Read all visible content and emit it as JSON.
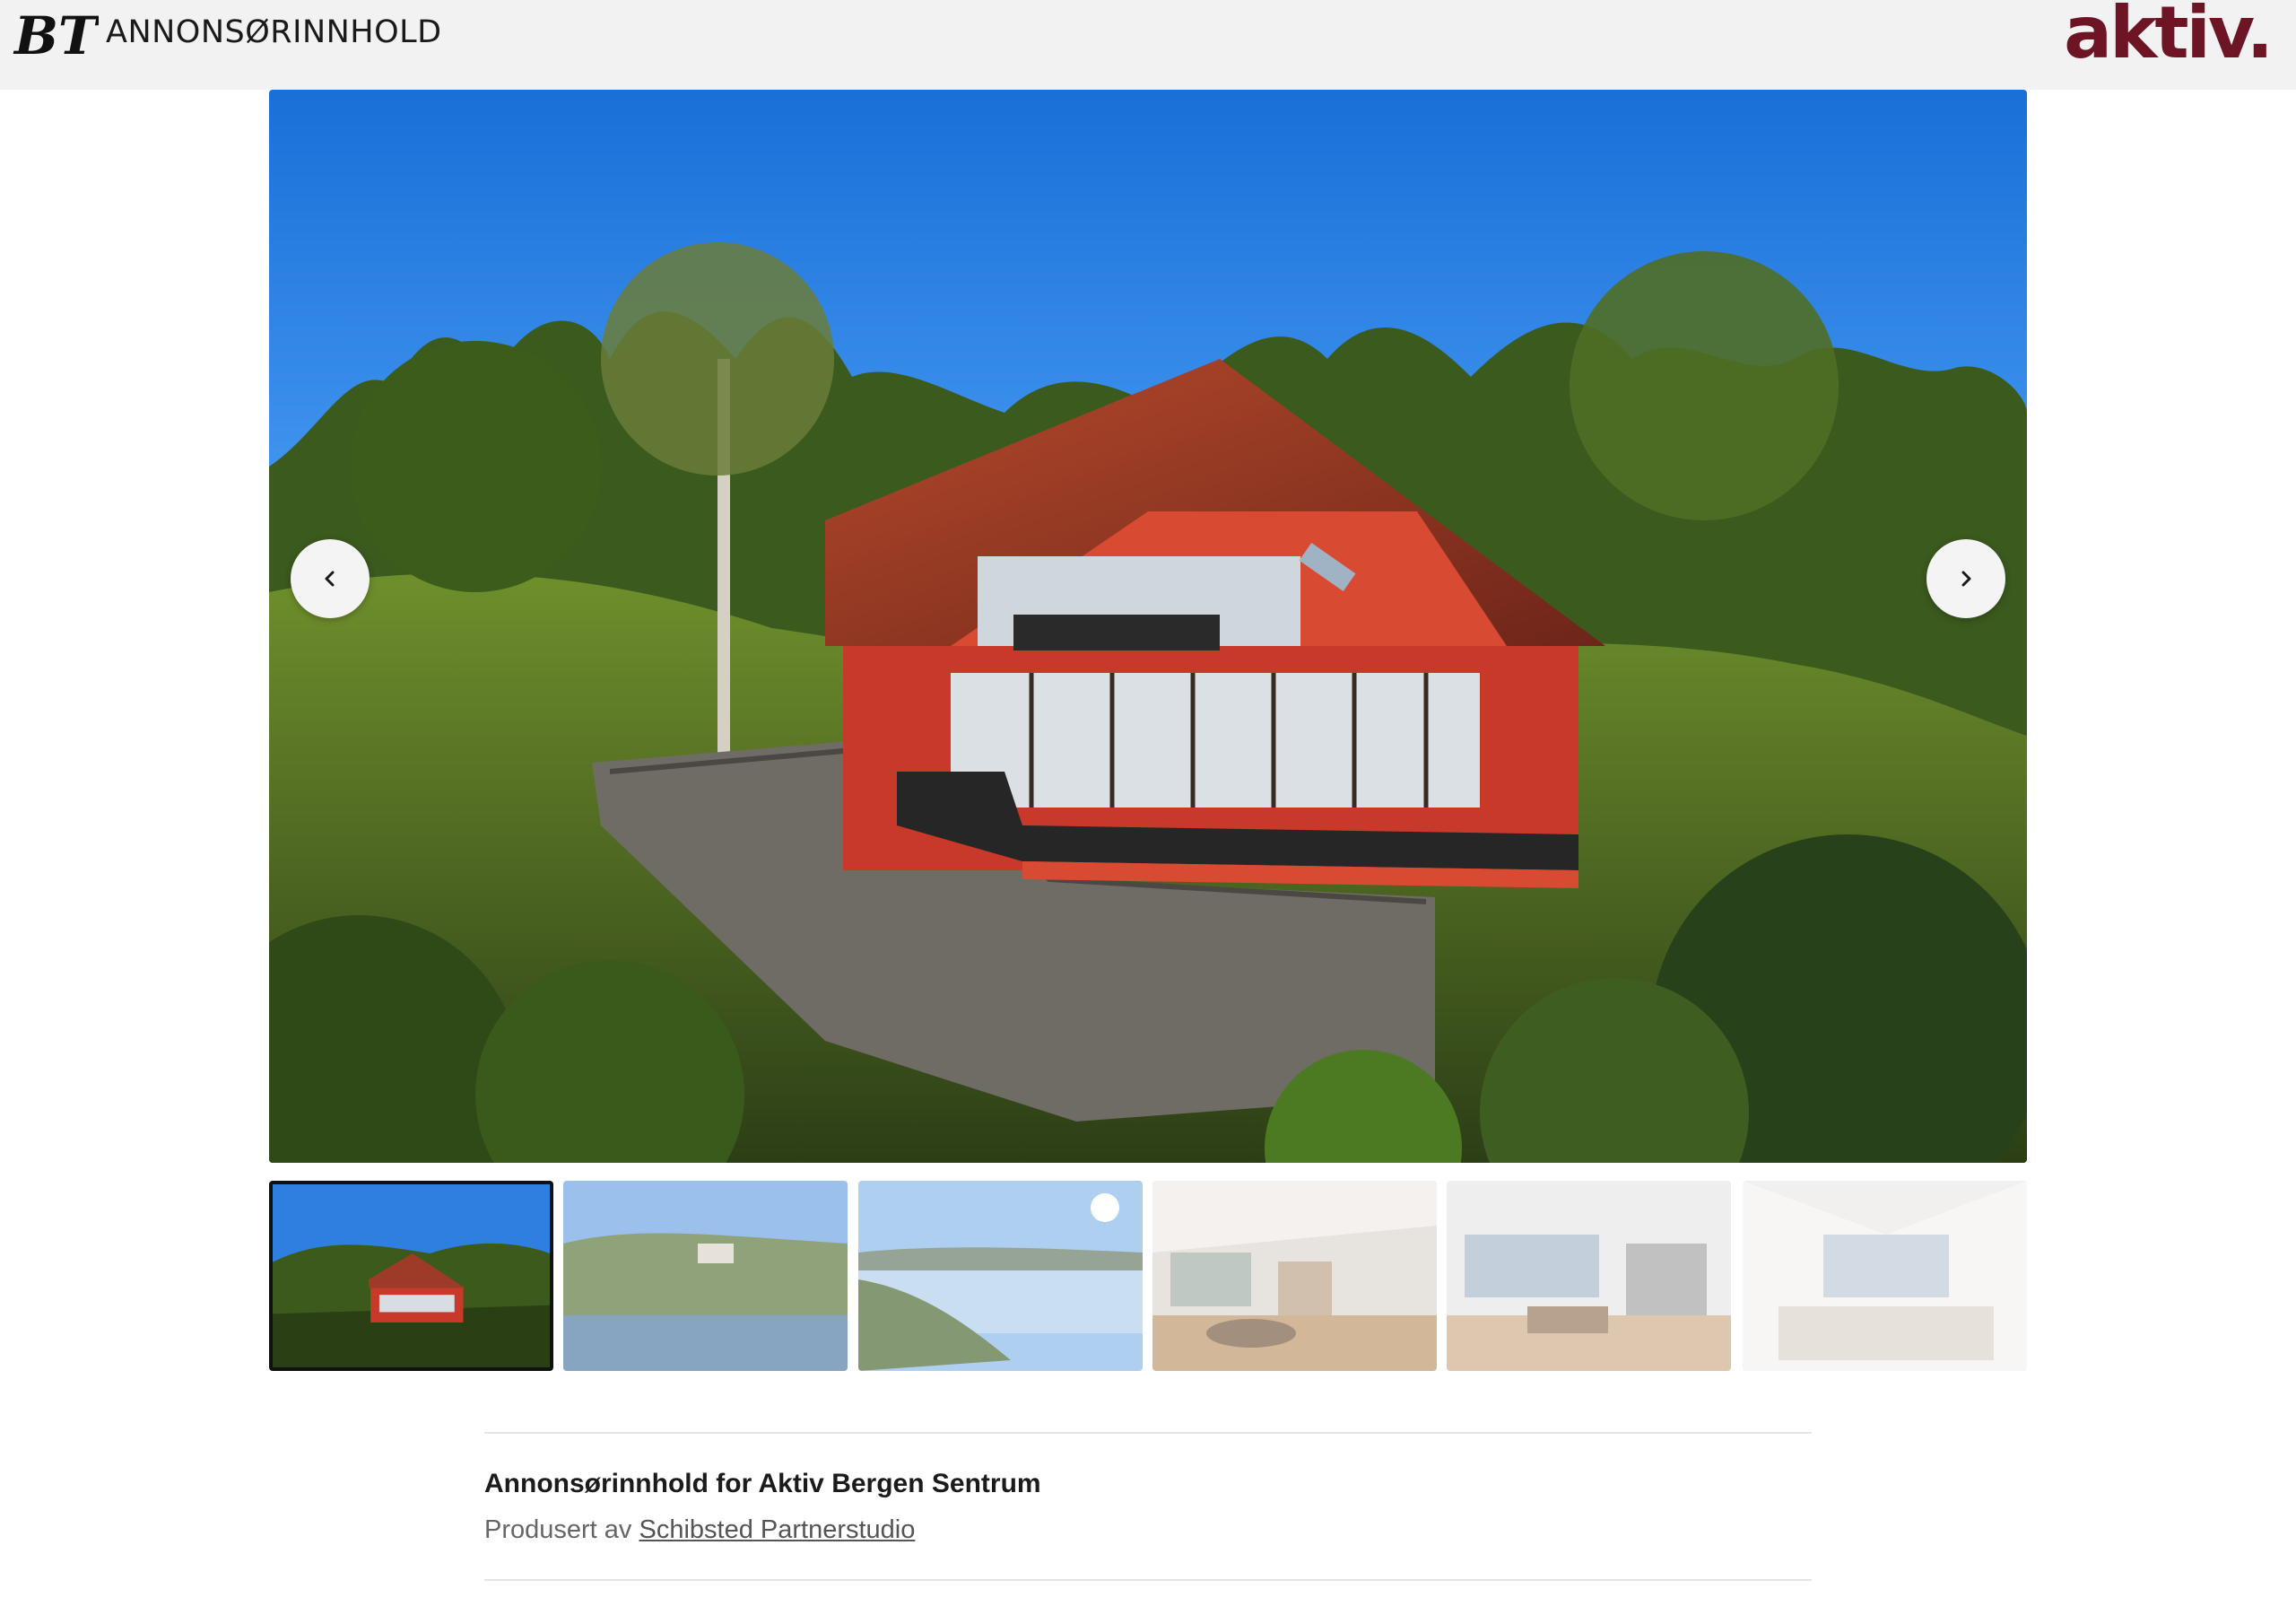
{
  "header": {
    "bt_logo_text": "BT",
    "label": "ANNONSØRINNHOLD",
    "advertiser_logo": "aktiv."
  },
  "gallery": {
    "prev_icon": "chevron-left-icon",
    "next_icon": "chevron-right-icon",
    "active_index": 0,
    "thumbnails": [
      {
        "subject": "red house aerial"
      },
      {
        "subject": "lakeside view"
      },
      {
        "subject": "fjord panorama"
      },
      {
        "subject": "living room"
      },
      {
        "subject": "kitchen and dining"
      },
      {
        "subject": "attic bedroom"
      }
    ]
  },
  "caption": {
    "title": "Annonsørinnhold for Aktiv Bergen Sentrum",
    "produced_by_prefix": "Produsert av",
    "producer_link": "Schibsted Partnerstudio"
  },
  "colors": {
    "brand": "#6d1524",
    "header_bg": "#f2f2f2"
  }
}
